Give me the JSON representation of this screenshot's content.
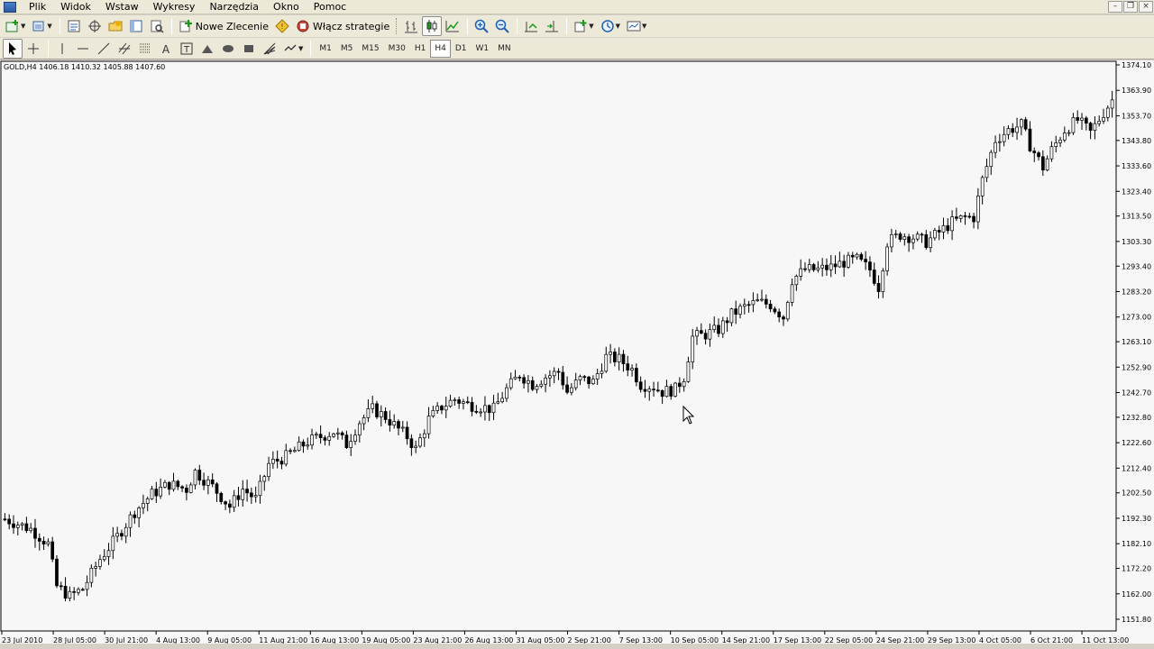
{
  "window": {
    "menu": [
      "Plik",
      "Widok",
      "Wstaw",
      "Wykresy",
      "Narzędzia",
      "Okno",
      "Pomoc"
    ]
  },
  "toolbar": {
    "new_order_label": "Nowe Zlecenie",
    "strategies_label": "Włącz strategie"
  },
  "timeframes": [
    "M1",
    "M5",
    "M15",
    "M30",
    "H1",
    "H4",
    "D1",
    "W1",
    "MN"
  ],
  "active_timeframe": "H4",
  "chart": {
    "info_line": "GOLD,H4  1406.18 1410.32 1405.88 1407.60",
    "price_ticks": [
      "1374.10",
      "1363.90",
      "1353.70",
      "1343.80",
      "1333.60",
      "1323.40",
      "1313.50",
      "1303.30",
      "1293.40",
      "1283.20",
      "1273.00",
      "1263.10",
      "1252.90",
      "1242.70",
      "1232.80",
      "1222.60",
      "1212.40",
      "1202.50",
      "1192.30",
      "1182.10",
      "1172.20",
      "1162.00",
      "1151.80"
    ],
    "time_ticks": [
      "23 Jul 2010",
      "28 Jul 05:00",
      "30 Jul 21:00",
      "4 Aug 13:00",
      "9 Aug 05:00",
      "11 Aug 21:00",
      "16 Aug 13:00",
      "19 Aug 05:00",
      "23 Aug 21:00",
      "26 Aug 13:00",
      "31 Aug 05:00",
      "2 Sep 21:00",
      "7 Sep 13:00",
      "10 Sep 05:00",
      "14 Sep 21:00",
      "17 Sep 13:00",
      "22 Sep 05:00",
      "24 Sep 21:00",
      "29 Sep 13:00",
      "4 Oct 05:00",
      "6 Oct 21:00",
      "11 Oct 13:00"
    ],
    "colors": {
      "background": "#f7f7f7",
      "bull": "#ffffff",
      "bear": "#000000",
      "wick": "#000000",
      "axis": "#000000"
    }
  },
  "chart_data": {
    "type": "candlestick",
    "symbol": "GOLD",
    "timeframe": "H4",
    "ylim": [
      1151.8,
      1374.1
    ],
    "anchors": [
      [
        0,
        1192
      ],
      [
        6,
        1188
      ],
      [
        10,
        1182
      ],
      [
        12,
        1165
      ],
      [
        15,
        1161
      ],
      [
        18,
        1164
      ],
      [
        22,
        1176
      ],
      [
        26,
        1185
      ],
      [
        30,
        1195
      ],
      [
        34,
        1202
      ],
      [
        38,
        1206
      ],
      [
        42,
        1204
      ],
      [
        44,
        1211
      ],
      [
        48,
        1205
      ],
      [
        52,
        1197
      ],
      [
        55,
        1204
      ],
      [
        58,
        1200
      ],
      [
        61,
        1214
      ],
      [
        65,
        1217
      ],
      [
        70,
        1223
      ],
      [
        73,
        1225
      ],
      [
        76,
        1227
      ],
      [
        79,
        1222
      ],
      [
        82,
        1231
      ],
      [
        85,
        1236
      ],
      [
        88,
        1233
      ],
      [
        91,
        1228
      ],
      [
        93,
        1225
      ],
      [
        95,
        1220
      ],
      [
        98,
        1232
      ],
      [
        101,
        1237
      ],
      [
        104,
        1240
      ],
      [
        107,
        1238
      ],
      [
        110,
        1237
      ],
      [
        113,
        1236
      ],
      [
        116,
        1244
      ],
      [
        119,
        1250
      ],
      [
        122,
        1246
      ],
      [
        125,
        1249
      ],
      [
        128,
        1251
      ],
      [
        130,
        1243
      ],
      [
        133,
        1248
      ],
      [
        136,
        1247
      ],
      [
        139,
        1257
      ],
      [
        142,
        1256
      ],
      [
        145,
        1252
      ],
      [
        147,
        1246
      ],
      [
        150,
        1245
      ],
      [
        152,
        1243
      ],
      [
        155,
        1244
      ],
      [
        157,
        1249
      ],
      [
        159,
        1265
      ],
      [
        162,
        1266
      ],
      [
        165,
        1268
      ],
      [
        168,
        1274
      ],
      [
        171,
        1277
      ],
      [
        174,
        1279
      ],
      [
        177,
        1278
      ],
      [
        180,
        1273
      ],
      [
        182,
        1288
      ],
      [
        185,
        1292
      ],
      [
        188,
        1292
      ],
      [
        191,
        1293
      ],
      [
        194,
        1295
      ],
      [
        197,
        1296
      ],
      [
        200,
        1292
      ],
      [
        202,
        1285
      ],
      [
        204,
        1303
      ],
      [
        207,
        1306
      ],
      [
        210,
        1305
      ],
      [
        213,
        1303
      ],
      [
        216,
        1307
      ],
      [
        219,
        1311
      ],
      [
        222,
        1313
      ],
      [
        224,
        1313
      ],
      [
        226,
        1328
      ],
      [
        229,
        1344
      ],
      [
        232,
        1348
      ],
      [
        235,
        1350
      ],
      [
        237,
        1342
      ],
      [
        240,
        1333
      ],
      [
        242,
        1340
      ],
      [
        245,
        1348
      ],
      [
        248,
        1352
      ],
      [
        251,
        1347
      ],
      [
        254,
        1355
      ],
      [
        256,
        1360
      ]
    ],
    "candle_count": 257
  }
}
